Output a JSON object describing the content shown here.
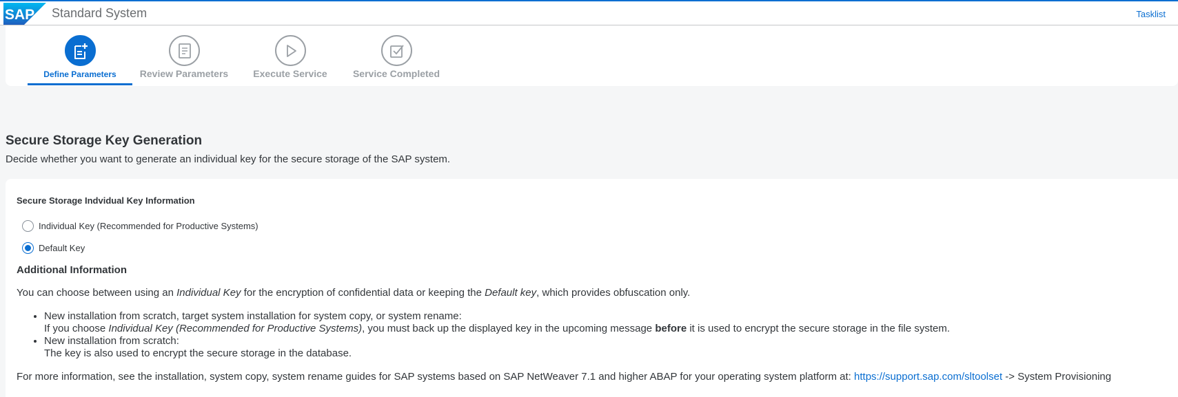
{
  "header": {
    "logo_text": "SAP",
    "app_title": "Standard System",
    "tasklist_label": "Tasklist"
  },
  "wizard": {
    "steps": [
      {
        "label": "Define Parameters",
        "icon": "document-add-icon",
        "state": "active"
      },
      {
        "label": "Review Parameters",
        "icon": "checklist-icon",
        "state": "inactive"
      },
      {
        "label": "Execute Service",
        "icon": "play-icon",
        "state": "inactive"
      },
      {
        "label": "Service Completed",
        "icon": "checkbox-icon",
        "state": "inactive"
      }
    ]
  },
  "section": {
    "title": "Secure Storage Key Generation",
    "description": "Decide whether you want to generate an individual key for the secure storage of the SAP system."
  },
  "panel": {
    "label": "Secure Storage Indvidual Key Information",
    "options": [
      {
        "label": "Individual Key (Recommended for Productive Systems)",
        "selected": false
      },
      {
        "label": "Default Key",
        "selected": true
      }
    ]
  },
  "info": {
    "title": "Additional Information",
    "intro_1": "You can choose between using an ",
    "intro_em1": "Individual Key",
    "intro_2": " for the encryption of confidential data or keeping the ",
    "intro_em2": "Default key",
    "intro_3": ", which provides obfuscation only.",
    "bullets": [
      {
        "heading": "New installation from scratch, target system installation for system copy, or system rename:",
        "text_1": "If you choose ",
        "text_em": "Individual Key (Recommended for Productive Systems)",
        "text_2": ", you must back up the displayed key in the upcoming message ",
        "text_bold": "before",
        "text_3": " it is used to encrypt the secure storage in the file system."
      },
      {
        "heading": "New installation from scratch:",
        "text": "The key is also used to encrypt the secure storage in the database."
      }
    ],
    "more_1": "For more information, see the installation, system copy, system rename guides for SAP systems based on SAP NetWeaver 7.1 and higher ABAP for your operating system platform at: ",
    "more_link": "https://support.sap.com/sltoolset",
    "more_2": " -> System Provisioning"
  },
  "colors": {
    "accent": "#0a6ed1",
    "inactive": "#9ba0a5",
    "text": "#32363a",
    "background": "#f5f6f7"
  }
}
